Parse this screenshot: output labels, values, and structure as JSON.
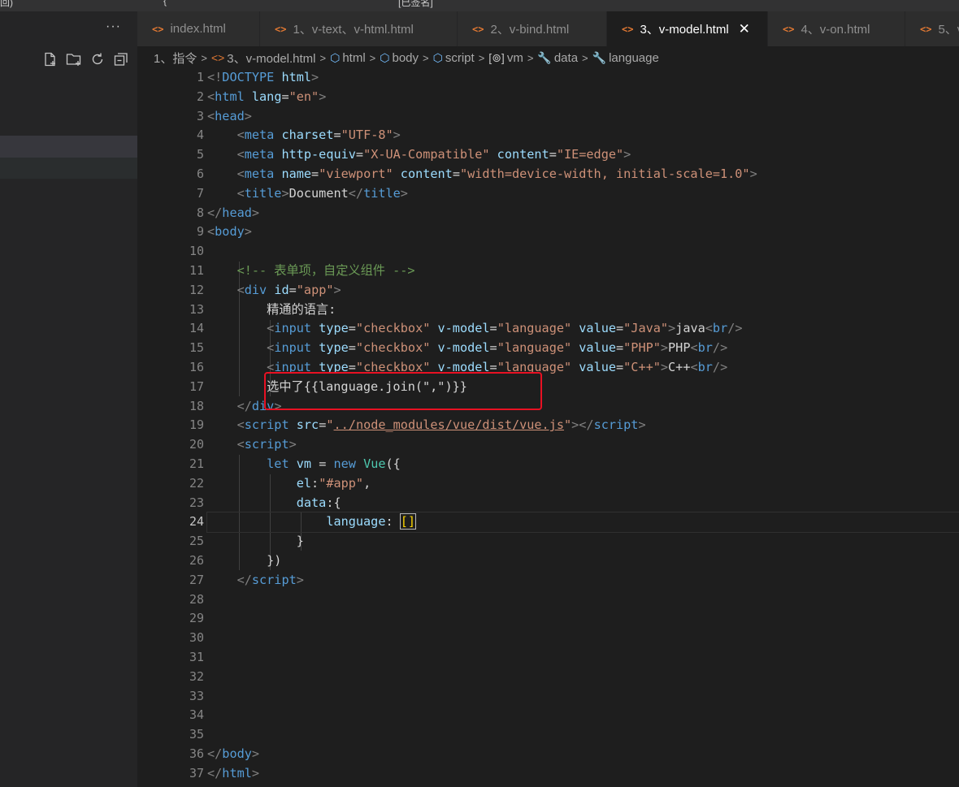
{
  "window": {
    "top_fragments": [
      "回)",
      "{",
      "[已签名]"
    ]
  },
  "sidebar": {
    "more_label": "···",
    "actions": [
      {
        "name": "new-file-icon"
      },
      {
        "name": "new-folder-icon"
      },
      {
        "name": "refresh-icon"
      },
      {
        "name": "collapse-all-icon"
      }
    ]
  },
  "tabs": [
    {
      "label": "index.html",
      "active": false
    },
    {
      "label": "1、v-text、v-html.html",
      "active": false
    },
    {
      "label": "2、v-bind.html",
      "active": false
    },
    {
      "label": "3、v-model.html",
      "active": true
    },
    {
      "label": "4、v-on.html",
      "active": false
    },
    {
      "label": "5、v",
      "active": false
    }
  ],
  "tab_icon_glyph": "<>",
  "tab_close_glyph": "✕",
  "breadcrumb": [
    {
      "label": "1、指令",
      "icon": ""
    },
    {
      "label": "3、v-model.html",
      "icon": "<>"
    },
    {
      "label": "html",
      "icon": "⬡"
    },
    {
      "label": "body",
      "icon": "⬡"
    },
    {
      "label": "script",
      "icon": "⬡"
    },
    {
      "label": "vm",
      "icon": "[⊚]"
    },
    {
      "label": "data",
      "icon": "🔧"
    },
    {
      "label": "language",
      "icon": "🔧"
    }
  ],
  "editor": {
    "current_line": 24,
    "highlight_note": "选中了{{language.join(\",\")}}",
    "lines": [
      [
        [
          "br",
          "<!"
        ],
        [
          "tag",
          "DOCTYPE"
        ],
        [
          "txt",
          " "
        ],
        [
          "attr",
          "html"
        ],
        [
          "br",
          ">"
        ]
      ],
      [
        [
          "br",
          "<"
        ],
        [
          "tag",
          "html"
        ],
        [
          "txt",
          " "
        ],
        [
          "attr",
          "lang"
        ],
        [
          "txt",
          "="
        ],
        [
          "str",
          "\"en\""
        ],
        [
          "br",
          ">"
        ]
      ],
      [
        [
          "br",
          "<"
        ],
        [
          "tag",
          "head"
        ],
        [
          "br",
          ">"
        ]
      ],
      [
        [
          "txt",
          "    "
        ],
        [
          "br",
          "<"
        ],
        [
          "tag",
          "meta"
        ],
        [
          "txt",
          " "
        ],
        [
          "attr",
          "charset"
        ],
        [
          "txt",
          "="
        ],
        [
          "str",
          "\"UTF-8\""
        ],
        [
          "br",
          ">"
        ]
      ],
      [
        [
          "txt",
          "    "
        ],
        [
          "br",
          "<"
        ],
        [
          "tag",
          "meta"
        ],
        [
          "txt",
          " "
        ],
        [
          "attr",
          "http-equiv"
        ],
        [
          "txt",
          "="
        ],
        [
          "str",
          "\"X-UA-Compatible\""
        ],
        [
          "txt",
          " "
        ],
        [
          "attr",
          "content"
        ],
        [
          "txt",
          "="
        ],
        [
          "str",
          "\"IE=edge\""
        ],
        [
          "br",
          ">"
        ]
      ],
      [
        [
          "txt",
          "    "
        ],
        [
          "br",
          "<"
        ],
        [
          "tag",
          "meta"
        ],
        [
          "txt",
          " "
        ],
        [
          "attr",
          "name"
        ],
        [
          "txt",
          "="
        ],
        [
          "str",
          "\"viewport\""
        ],
        [
          "txt",
          " "
        ],
        [
          "attr",
          "content"
        ],
        [
          "txt",
          "="
        ],
        [
          "str",
          "\"width=device-width, initial-scale=1.0\""
        ],
        [
          "br",
          ">"
        ]
      ],
      [
        [
          "txt",
          "    "
        ],
        [
          "br",
          "<"
        ],
        [
          "tag",
          "title"
        ],
        [
          "br",
          ">"
        ],
        [
          "txt",
          "Document"
        ],
        [
          "br",
          "</"
        ],
        [
          "tag",
          "title"
        ],
        [
          "br",
          ">"
        ]
      ],
      [
        [
          "br",
          "</"
        ],
        [
          "tag",
          "head"
        ],
        [
          "br",
          ">"
        ]
      ],
      [
        [
          "br",
          "<"
        ],
        [
          "tag",
          "body"
        ],
        [
          "br",
          ">"
        ]
      ],
      [],
      [
        [
          "txt",
          "    "
        ],
        [
          "com",
          "<!-- 表单项，自定义组件 -->"
        ]
      ],
      [
        [
          "txt",
          "    "
        ],
        [
          "br",
          "<"
        ],
        [
          "tag",
          "div"
        ],
        [
          "txt",
          " "
        ],
        [
          "attr",
          "id"
        ],
        [
          "txt",
          "="
        ],
        [
          "str",
          "\"app\""
        ],
        [
          "br",
          ">"
        ]
      ],
      [
        [
          "txt",
          "        精通的语言:"
        ]
      ],
      [
        [
          "txt",
          "        "
        ],
        [
          "br",
          "<"
        ],
        [
          "tag",
          "input"
        ],
        [
          "txt",
          " "
        ],
        [
          "attr",
          "type"
        ],
        [
          "txt",
          "="
        ],
        [
          "str",
          "\"checkbox\""
        ],
        [
          "txt",
          " "
        ],
        [
          "attr",
          "v-model"
        ],
        [
          "txt",
          "="
        ],
        [
          "str",
          "\"language\""
        ],
        [
          "txt",
          " "
        ],
        [
          "attr",
          "value"
        ],
        [
          "txt",
          "="
        ],
        [
          "str",
          "\"Java\""
        ],
        [
          "br",
          ">"
        ],
        [
          "txt",
          "java"
        ],
        [
          "br",
          "<"
        ],
        [
          "tag",
          "br"
        ],
        [
          "br",
          "/>"
        ]
      ],
      [
        [
          "txt",
          "        "
        ],
        [
          "br",
          "<"
        ],
        [
          "tag",
          "input"
        ],
        [
          "txt",
          " "
        ],
        [
          "attr",
          "type"
        ],
        [
          "txt",
          "="
        ],
        [
          "str",
          "\"checkbox\""
        ],
        [
          "txt",
          " "
        ],
        [
          "attr",
          "v-model"
        ],
        [
          "txt",
          "="
        ],
        [
          "str",
          "\"language\""
        ],
        [
          "txt",
          " "
        ],
        [
          "attr",
          "value"
        ],
        [
          "txt",
          "="
        ],
        [
          "str",
          "\"PHP\""
        ],
        [
          "br",
          ">"
        ],
        [
          "txt",
          "PHP"
        ],
        [
          "br",
          "<"
        ],
        [
          "tag",
          "br"
        ],
        [
          "br",
          "/>"
        ]
      ],
      [
        [
          "txt",
          "        "
        ],
        [
          "br",
          "<"
        ],
        [
          "tag",
          "input"
        ],
        [
          "txt",
          " "
        ],
        [
          "attr",
          "type"
        ],
        [
          "txt",
          "="
        ],
        [
          "str",
          "\"checkbox\""
        ],
        [
          "txt",
          " "
        ],
        [
          "attr",
          "v-model"
        ],
        [
          "txt",
          "="
        ],
        [
          "str",
          "\"language\""
        ],
        [
          "txt",
          " "
        ],
        [
          "attr",
          "value"
        ],
        [
          "txt",
          "="
        ],
        [
          "str",
          "\"C++\""
        ],
        [
          "br",
          ">"
        ],
        [
          "txt",
          "C++"
        ],
        [
          "br",
          "<"
        ],
        [
          "tag",
          "br"
        ],
        [
          "br",
          "/>"
        ]
      ],
      [
        [
          "txt",
          "        选中了{{language.join(\",\")}}"
        ]
      ],
      [
        [
          "txt",
          "    "
        ],
        [
          "br",
          "</"
        ],
        [
          "tag",
          "div"
        ],
        [
          "br",
          ">"
        ]
      ],
      [
        [
          "txt",
          "    "
        ],
        [
          "br",
          "<"
        ],
        [
          "tag",
          "script"
        ],
        [
          "txt",
          " "
        ],
        [
          "attr",
          "src"
        ],
        [
          "txt",
          "="
        ],
        [
          "str",
          "\""
        ],
        [
          "lnk",
          "../node_modules/vue/dist/vue.js"
        ],
        [
          "str",
          "\""
        ],
        [
          "br",
          "></"
        ],
        [
          "tag",
          "script"
        ],
        [
          "br",
          ">"
        ]
      ],
      [
        [
          "txt",
          "    "
        ],
        [
          "br",
          "<"
        ],
        [
          "tag",
          "script"
        ],
        [
          "br",
          ">"
        ]
      ],
      [
        [
          "txt",
          "        "
        ],
        [
          "kw",
          "let"
        ],
        [
          "txt",
          " "
        ],
        [
          "var",
          "vm"
        ],
        [
          "txt",
          " = "
        ],
        [
          "kw",
          "new"
        ],
        [
          "txt",
          " "
        ],
        [
          "cls",
          "Vue"
        ],
        [
          "txt",
          "({"
        ]
      ],
      [
        [
          "txt",
          "            "
        ],
        [
          "var",
          "el"
        ],
        [
          "txt",
          ":"
        ],
        [
          "str",
          "\"#app\""
        ],
        [
          "txt",
          ","
        ]
      ],
      [
        [
          "txt",
          "            "
        ],
        [
          "var",
          "data"
        ],
        [
          "txt",
          ":{"
        ]
      ],
      [
        [
          "txt",
          "                "
        ],
        [
          "var",
          "language"
        ],
        [
          "txt",
          ": "
        ],
        [
          "bracket",
          "[]"
        ]
      ],
      [
        [
          "txt",
          "            }"
        ]
      ],
      [
        [
          "txt",
          "        })"
        ]
      ],
      [
        [
          "txt",
          "    "
        ],
        [
          "br",
          "</"
        ],
        [
          "tag",
          "script"
        ],
        [
          "br",
          ">"
        ]
      ],
      [],
      [],
      [],
      [],
      [],
      [],
      [],
      [],
      [
        [
          "br",
          "</"
        ],
        [
          "tag",
          "body"
        ],
        [
          "br",
          ">"
        ]
      ],
      [
        [
          "br",
          "</"
        ],
        [
          "tag",
          "html"
        ],
        [
          "br",
          ">"
        ]
      ]
    ]
  }
}
